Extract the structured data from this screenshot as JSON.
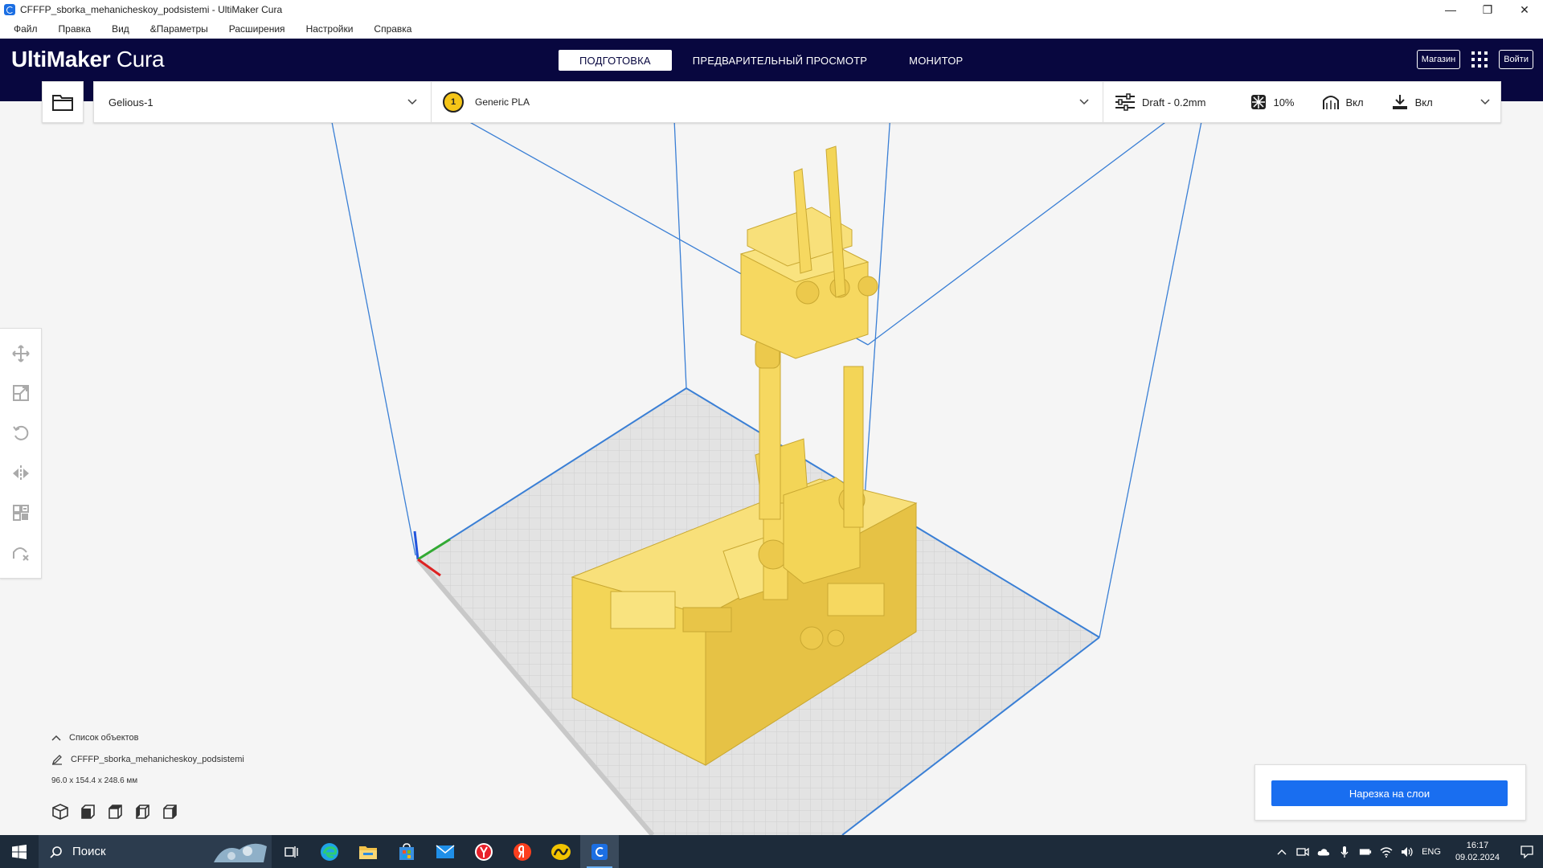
{
  "window": {
    "title": "CFFFP_sborka_mehanicheskoy_podsistemi - UltiMaker Cura",
    "controls": {
      "minimize": "—",
      "restore": "❐",
      "close": "✕"
    }
  },
  "menu": [
    "Файл",
    "Правка",
    "Вид",
    "&Параметры",
    "Расширения",
    "Настройки",
    "Справка"
  ],
  "header": {
    "logo_bold": "UltiMaker",
    "logo_light": "Cura",
    "stages": [
      "ПОДГОТОВКА",
      "ПРЕДВАРИТЕЛЬНЫЙ ПРОСМОТР",
      "МОНИТОР"
    ],
    "active_stage": "ПОДГОТОВКА",
    "marketplace_label": "Магазин",
    "signin_label": "Войти"
  },
  "printer_bar": {
    "machine": "Gelious-1",
    "extruder_number": "1",
    "material": "Generic PLA",
    "profile": "Draft - 0.2mm",
    "infill": "10%",
    "support": "Вкл",
    "adhesion": "Вкл"
  },
  "object_list": {
    "title": "Список объектов",
    "object_name": "CFFFP_sborka_mehanicheskoy_podsistemi",
    "dimensions": "96.0 x 154.4 x 248.6 мм"
  },
  "slice_button_label": "Нарезка на слои",
  "taskbar": {
    "search_placeholder": "Поиск",
    "language": "ENG",
    "time": "16:17",
    "date": "09.02.2024"
  },
  "colors": {
    "header_bg": "#08073f",
    "accent_blue": "#196ef0",
    "model_yellow": "#f6d860",
    "build_volume_lines": "#3a7fd5"
  }
}
